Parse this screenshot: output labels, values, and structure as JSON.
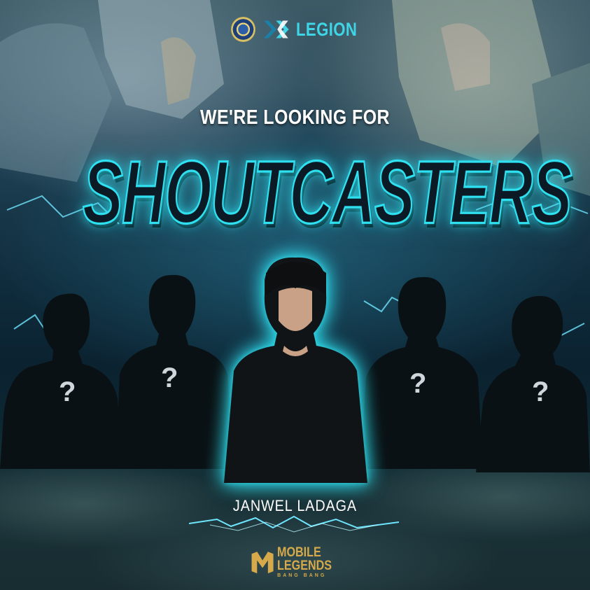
{
  "header": {
    "brand_name": "LEGION",
    "seal_icon": "university-seal-icon",
    "logo_icon": "legion-logo-icon"
  },
  "headline": {
    "kicker": "WE'RE LOOKING FOR",
    "title": "SHOUTCASTERS"
  },
  "silhouettes": [
    {
      "mark": "?"
    },
    {
      "mark": "?"
    },
    {
      "mark": "?"
    },
    {
      "mark": "?"
    }
  ],
  "featured": {
    "name": "JANWEL LADAGA"
  },
  "footer": {
    "logo_line1": "MOBILE",
    "logo_line2": "LEGENDS",
    "logo_line3": "BANG BANG",
    "logo_icon": "mobile-legends-logo-icon"
  },
  "colors": {
    "accent": "#2fe0f0",
    "brand_text": "#3fd4e6",
    "gold": "#d6a94a",
    "background": "#0f2c3c"
  }
}
